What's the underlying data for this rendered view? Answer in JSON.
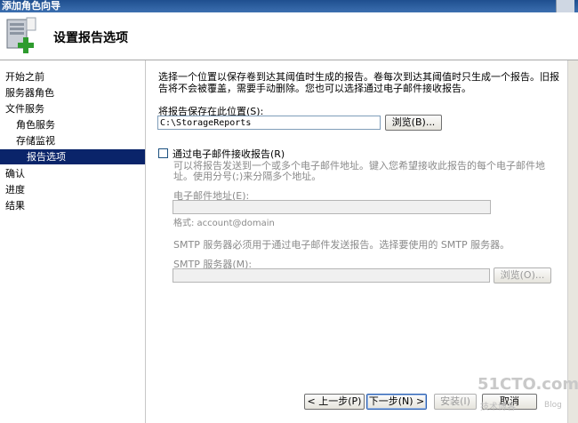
{
  "window": {
    "title": "添加角色向导"
  },
  "header": {
    "title": "设置报告选项"
  },
  "sidebar": {
    "items": [
      {
        "label": "开始之前"
      },
      {
        "label": "服务器角色"
      },
      {
        "label": "文件服务"
      },
      {
        "label": "角色服务"
      },
      {
        "label": "存储监视"
      },
      {
        "label": "报告选项"
      },
      {
        "label": "确认"
      },
      {
        "label": "进度"
      },
      {
        "label": "结果"
      }
    ]
  },
  "main": {
    "intro": "选择一个位置以保存卷到达其阈值时生成的报告。卷每次到达其阈值时只生成一个报告。旧报告将不会被覆盖，需要手动删除。您也可以选择通过电子邮件接收报告。",
    "save_location_label": "将报告保存在此位置(S):",
    "save_location_value": "C:\\StorageReports",
    "browse_label": "浏览(B)...",
    "email_checkbox_label": "通过电子邮件接收报告(R)",
    "email_checkbox_checked": false,
    "email_help": "可以将报告发送到一个或多个电子邮件地址。键入您希望接收此报告的每个电子邮件地址。使用分号(;)来分隔多个地址。",
    "email_label": "电子邮件地址(E):",
    "email_value": "",
    "format_hint": "格式: account@domain",
    "smtp_help": "SMTP 服务器必须用于通过电子邮件发送报告。选择要使用的 SMTP 服务器。",
    "smtp_label": "SMTP 服务器(M):",
    "smtp_value": "",
    "smtp_browse_label": "浏览(O)..."
  },
  "footer": {
    "prev_label": "< 上一步(P)",
    "next_label": "下一步(N) >",
    "install_label": "安装(I)",
    "cancel_label": "取消"
  },
  "watermark": {
    "line1": "51CTO.com",
    "line2": "技术博客",
    "line3": "Blog"
  }
}
